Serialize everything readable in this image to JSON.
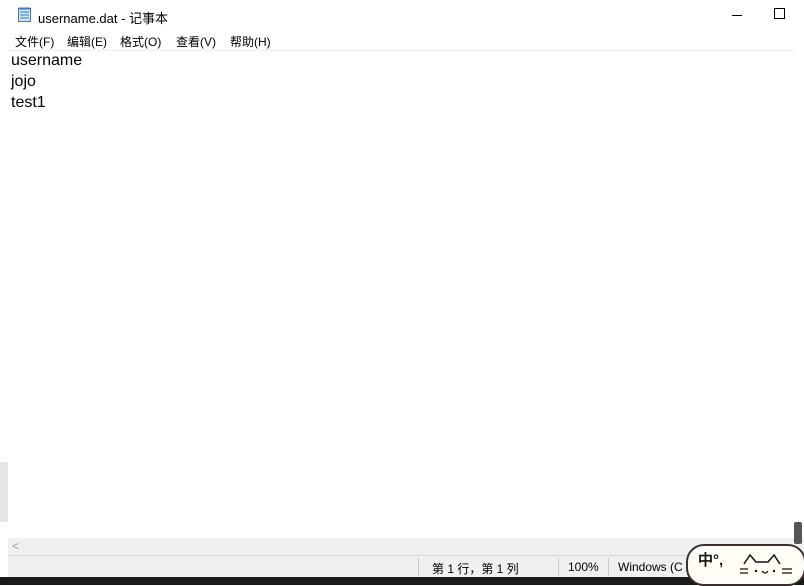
{
  "window": {
    "title": "username.dat - 记事本"
  },
  "menu": {
    "items": [
      "文件(F)",
      "编辑(E)",
      "格式(O)",
      "查看(V)",
      "帮助(H)"
    ]
  },
  "editor": {
    "lines": [
      "username",
      "jojo",
      "test1"
    ]
  },
  "scrollbar": {
    "left_arrow": "<"
  },
  "status": {
    "position": "第 1 行，第 1 列",
    "zoom": "100%",
    "encoding": "Windows (C"
  },
  "ime": {
    "mode": "中°,"
  }
}
